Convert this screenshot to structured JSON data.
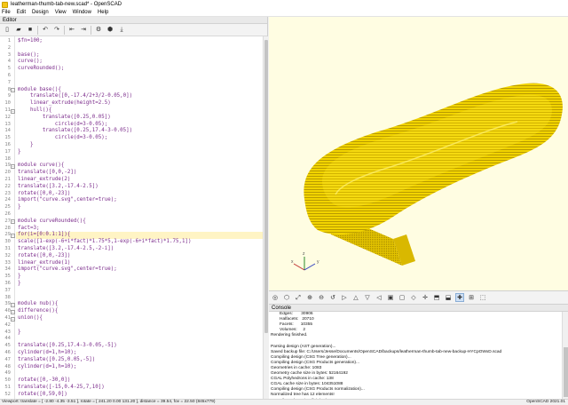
{
  "window": {
    "title": "leatherman-thumb-tab-new.scad* - OpenSCAD"
  },
  "menu": [
    "File",
    "Edit",
    "Design",
    "View",
    "Window",
    "Help"
  ],
  "editor": {
    "title": "Editor",
    "toolbar_icons": [
      "new-file-icon",
      "open-file-icon",
      "save-icon",
      "undo-icon",
      "redo-icon",
      "unindent-icon",
      "indent-icon",
      "preview-icon",
      "render-icon",
      "export-stl-icon"
    ],
    "current_line": 29,
    "lines": [
      "$fn=100;",
      "",
      "base();",
      "curve();",
      "curveRounded();",
      "",
      "",
      "module base(){",
      "    translate([0,-17.4/2+3/2-0.05,0])",
      "    linear_extrude(height=2.5)",
      "    hull(){",
      "        translate([0.25,0.05])",
      "            circle(d=3-0.05);",
      "        translate([0.25,17.4-3-0.05])",
      "            circle(d=3-0.05);",
      "    }",
      "}",
      "",
      "module curve(){",
      "translate([0,0,-2])",
      "linear_extrude(2)",
      "translate([3.2,-17.4-2.5])",
      "rotate([0,0,-23])",
      "import(\"curve.svg\",center=true);",
      "}",
      "",
      "module curveRounded(){",
      "fact=3;",
      "for(i=[0:0.1:1]){",
      "scale([1-exp(-6+i*fact)*1.75*5,1-exp(-6+i*fact)*1.75,1])",
      "translate([3.2,-17.4-2.5,-2-i])",
      "rotate([0,0,-23])",
      "linear_extrude(1)",
      "import(\"curve.svg\",center=true);",
      "}",
      "}",
      "",
      "",
      "module nub(){",
      "difference(){",
      "union(){",
      "",
      "}",
      "",
      "translate([0.25,17.4-3-0.05,-5])",
      "cylinder(d=1,h=10);",
      "translate([0.25,0.05,-5])",
      "cylinder(d=1,h=10);",
      "",
      "rotate([0,-30,0])",
      "translate([-15,0.4-25,7,10])",
      "rotate([0,59,0])",
      "for(i=[0:1:17]){"
    ]
  },
  "viewport": {
    "background": "#fffde2",
    "model_color": "#f5d800",
    "model_shadow": "#c9a700",
    "axis_labels": [
      "x",
      "y",
      "z"
    ]
  },
  "view_toolbar_icons": [
    "preview-3d-icon",
    "render-3d-icon",
    "view-all-icon",
    "zoom-in-icon",
    "zoom-out-icon",
    "reset-view-icon",
    "view-right-icon",
    "view-top-icon",
    "view-bottom-icon",
    "view-left-icon",
    "view-front-icon",
    "view-back-icon",
    "view-diagonal-icon",
    "view-center-icon",
    "perspective-icon",
    "orthogonal-icon",
    "show-axes-icon",
    "show-scale-icon",
    "show-edges-icon"
  ],
  "console": {
    "title": "Console",
    "stats": [
      "Edges:       30906",
      "Halfacets:   20710",
      "Facets:      10355",
      "Volumes:     2"
    ],
    "lines": [
      "Rendering finished.",
      "",
      "Parsing design (AST generation)...",
      "Saved backup file: C:/Users/Jesse/Documents/OpenSCAD/backups/leatherman-thumb-tab-new-backup-HYCpOWxD.scad",
      "Compiling design (CSG Tree generation)...",
      "Compiling design (CSG Products generation)...",
      "Geometries in cache: 1083",
      "Geometry cache size in bytes: 52164192",
      "CGAL Polyhedrons in cache: 138",
      "CGAL cache size in bytes: 104351088",
      "Compiling design (CSG Products normalization)...",
      "Normalized tree has 12 elements!",
      "Compile and preview finished.",
      "Total rendering time: 0:00:00.045"
    ]
  },
  "status": {
    "left": "Viewport: translate = [ -2.80 -4.35 -3.51 ], rotate = [ 241.20 0.00 131.20 ], distance = 39.54, fov = 22.50 (845x779)",
    "right": "OpenSCAD 2021.01"
  }
}
